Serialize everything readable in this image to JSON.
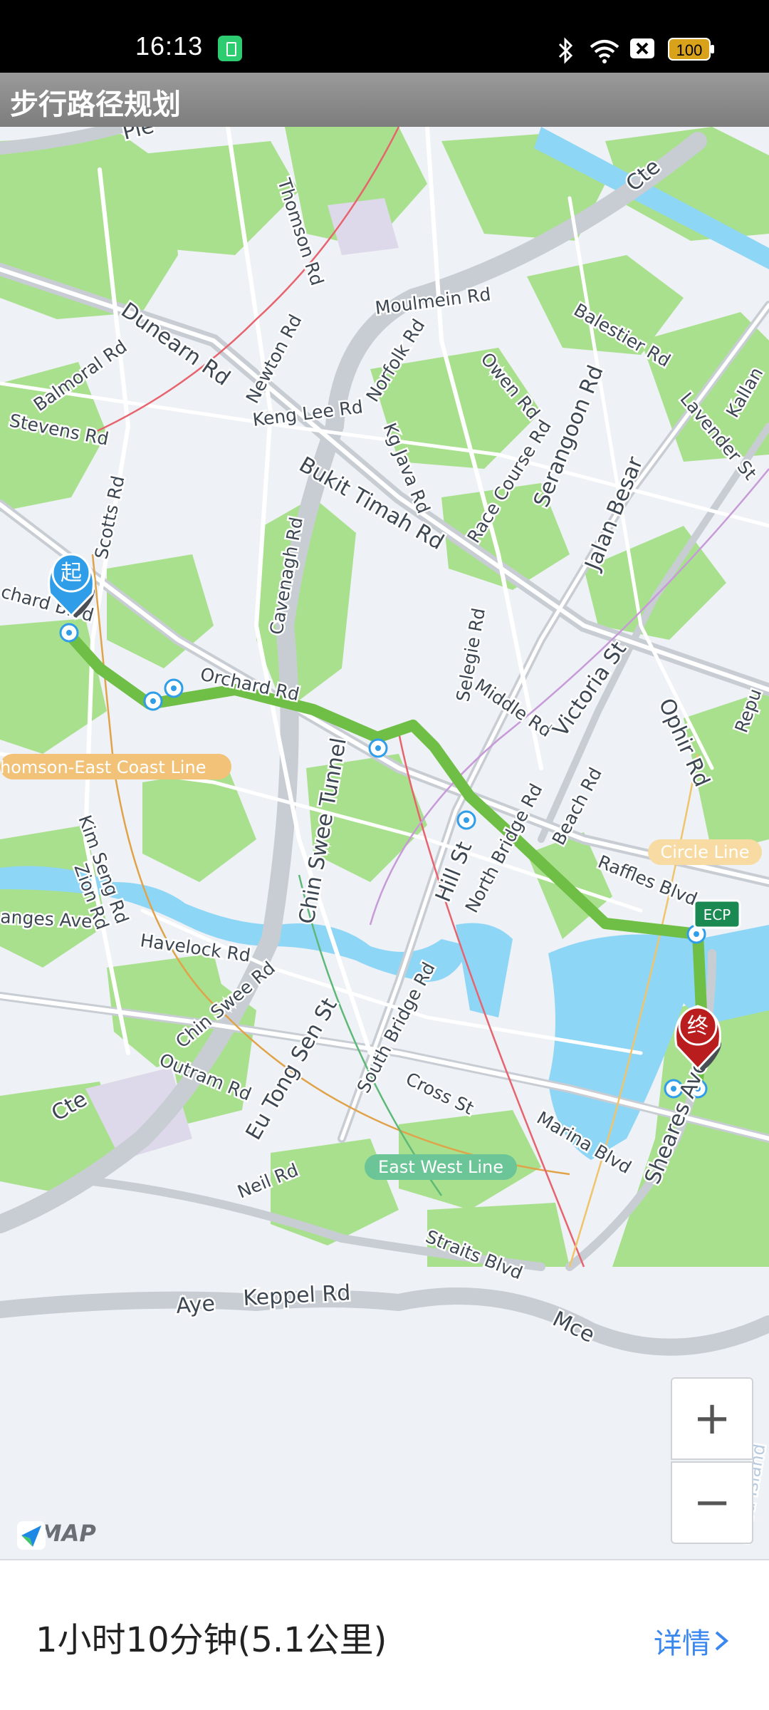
{
  "status_bar": {
    "time": "16:13",
    "battery": "100",
    "icons": [
      "app-icon",
      "bluetooth-icon",
      "wifi-icon",
      "sim-icon",
      "battery-icon"
    ]
  },
  "header": {
    "title": "步行路径规划"
  },
  "map": {
    "road_labels": {
      "pie": "Pie",
      "cte_top": "Cte",
      "thomson_rd": "Thomson Rd",
      "moulmein_rd": "Moulmein Rd",
      "balestier_rd": "Balestier Rd",
      "dunearn_rd": "Dunearn Rd",
      "newton_rd": "Newton Rd",
      "norfolk_rd": "Norfolk Rd",
      "owen_rd": "Owen Rd",
      "lavender_st": "Lavender St",
      "kallang": "Kallan",
      "balmoral_rd": "Balmoral Rd",
      "keng_lee_rd": "Keng Lee Rd",
      "stevens_rd": "Stevens Rd",
      "kg_java_rd": "Kg Java Rd",
      "race_course_rd": "Race Course Rd",
      "serangoon_rd": "Serangoon Rd",
      "jalan_besar": "Jalan Besar",
      "bukit_timah_rd": "Bukit Timah Rd",
      "scotts_rd": "Scotts Rd",
      "cavenagh_rd": "Cavenagh Rd",
      "orchard_blvd": "chard Blvd",
      "orchard_rd": "Orchard Rd",
      "selegie_rd": "Selegie Rd",
      "middle_rd": "Middle Rd",
      "victoria_st": "Victoria St",
      "ophir_rd": "Ophir Rd",
      "repu": "Repu",
      "thomson_east_coast_line": "homson-East Coast Line",
      "chin_swee_tunnel": "Chin Swee Tunnel",
      "beach_rd": "Beach Rd",
      "circle_line": "Circle Line",
      "kim_seng_rd": "Kim Seng Rd",
      "zion_rd": "Zion Rd",
      "hill_st": "Hill St",
      "north_bridge_rd": "North Bridge Rd",
      "raffles_blvd": "Raffles Blvd",
      "ecp": "ECP",
      "ganges_ave": "anges Ave",
      "havelock_rd": "Havelock Rd",
      "chin_swee_rd": "Chin Swee Rd",
      "eu_tong_sen_st": "Eu Tong Sen St",
      "south_bridge_rd": "South Bridge Rd",
      "cross_st": "Cross St",
      "marina_blvd": "Marina Blvd",
      "sheares_ave": "Sheares Ave",
      "cte_bottom": "Cte",
      "outram_rd": "Outram Rd",
      "east_west_line": "East West Line",
      "neil_rd": "Neil Rd",
      "straits_blvd": "Straits Blvd",
      "aye": "Aye",
      "keppel_rd": "Keppel Rd",
      "mce": "Mce",
      "kusu_island": "Kusu Island"
    },
    "start_marker": "起",
    "end_marker": "终",
    "zoom_in": "+",
    "zoom_out": "−",
    "logo": "AMAP",
    "colors": {
      "route": "#6fbe45",
      "park": "#a8e08a",
      "water": "#8fd7f7",
      "start": "#2f9de8",
      "end": "#b91d1d"
    }
  },
  "bottom": {
    "summary": "1小时10分钟(5.1公里)",
    "details": "详情"
  }
}
